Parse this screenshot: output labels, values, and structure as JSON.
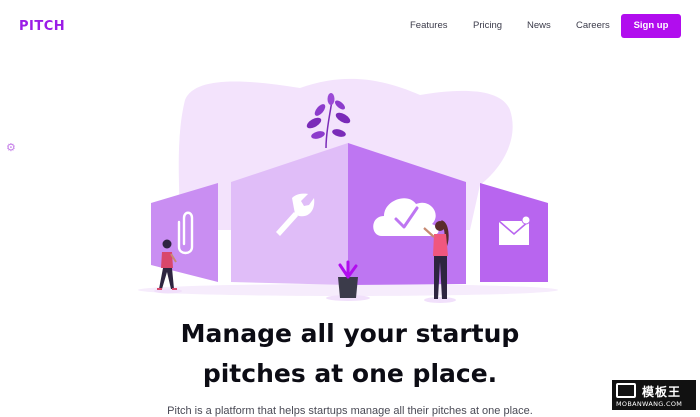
{
  "nav": {
    "logo": "PITCH",
    "links": [
      "Features",
      "Pricing",
      "News",
      "Careers"
    ],
    "signup_label": "Sign up"
  },
  "hero": {
    "headline_line1": "Manage all your startup",
    "headline_line2": "pitches at one place.",
    "subtext": "Pitch is a platform that helps startups manage all their pitches at one place."
  },
  "watermark": {
    "top": "模板王",
    "bottom": "MOBANWANG.COM"
  },
  "colors": {
    "brand": "#9b1ce6",
    "button": "#b10dee",
    "illustration_light": "#f1e0fb",
    "illustration_mid": "#d9a8f5",
    "illustration_dark": "#b865ef"
  },
  "icons": [
    "paperclip-icon",
    "wrench-icon",
    "cloud-check-icon",
    "envelope-icon",
    "gear-icon"
  ]
}
